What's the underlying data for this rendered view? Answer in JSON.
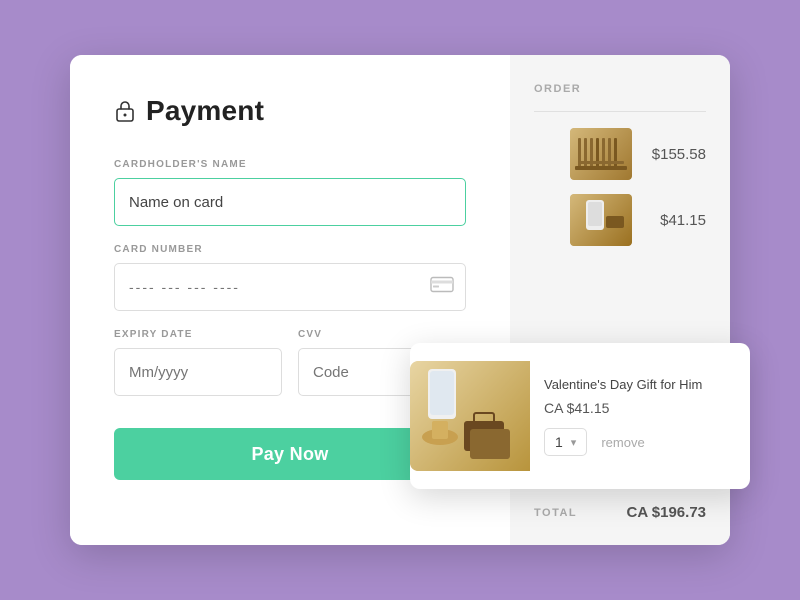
{
  "page": {
    "background_color": "#a78bca"
  },
  "header": {
    "icon": "🔒",
    "title": "Payment"
  },
  "form": {
    "cardholder_label": "CARDHOLDER'S NAME",
    "cardholder_placeholder": "Name on card",
    "card_number_label": "CARD NUMBER",
    "card_number_placeholder": "---- --- --- ----",
    "expiry_label": "EXPIRY DATE",
    "expiry_placeholder": "Mm/yyyy",
    "cvv_label": "CVV",
    "cvv_placeholder": "Code",
    "pay_button": "Pay Now"
  },
  "order": {
    "section_label": "ORDER",
    "items": [
      {
        "price": "$155.58"
      },
      {
        "price": "$41.15"
      }
    ],
    "total_label": "TOTAL",
    "total_value": "CA $196.73"
  },
  "tooltip": {
    "product_name": "Valentine's Day Gift for Him",
    "price": "CA  $41.15",
    "quantity": "1",
    "remove_label": "remove"
  }
}
